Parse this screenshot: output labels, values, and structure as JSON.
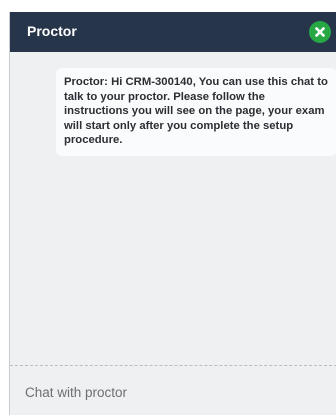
{
  "header": {
    "title": "Proctor",
    "close_icon": "close-icon"
  },
  "messages": [
    {
      "sender": "Proctor",
      "text": "Proctor: Hi CRM-300140, You can use this chat to talk to your proctor. Please follow the instructions you will see on the page, your exam will start only after you complete the setup procedure."
    }
  ],
  "chat_input": {
    "placeholder": "Chat with proctor",
    "value": ""
  },
  "colors": {
    "header_bg": "#26354a",
    "close_button": "#28a745",
    "panel_bg": "#eef0f2",
    "bubble_bg": "#f9fbfd"
  }
}
